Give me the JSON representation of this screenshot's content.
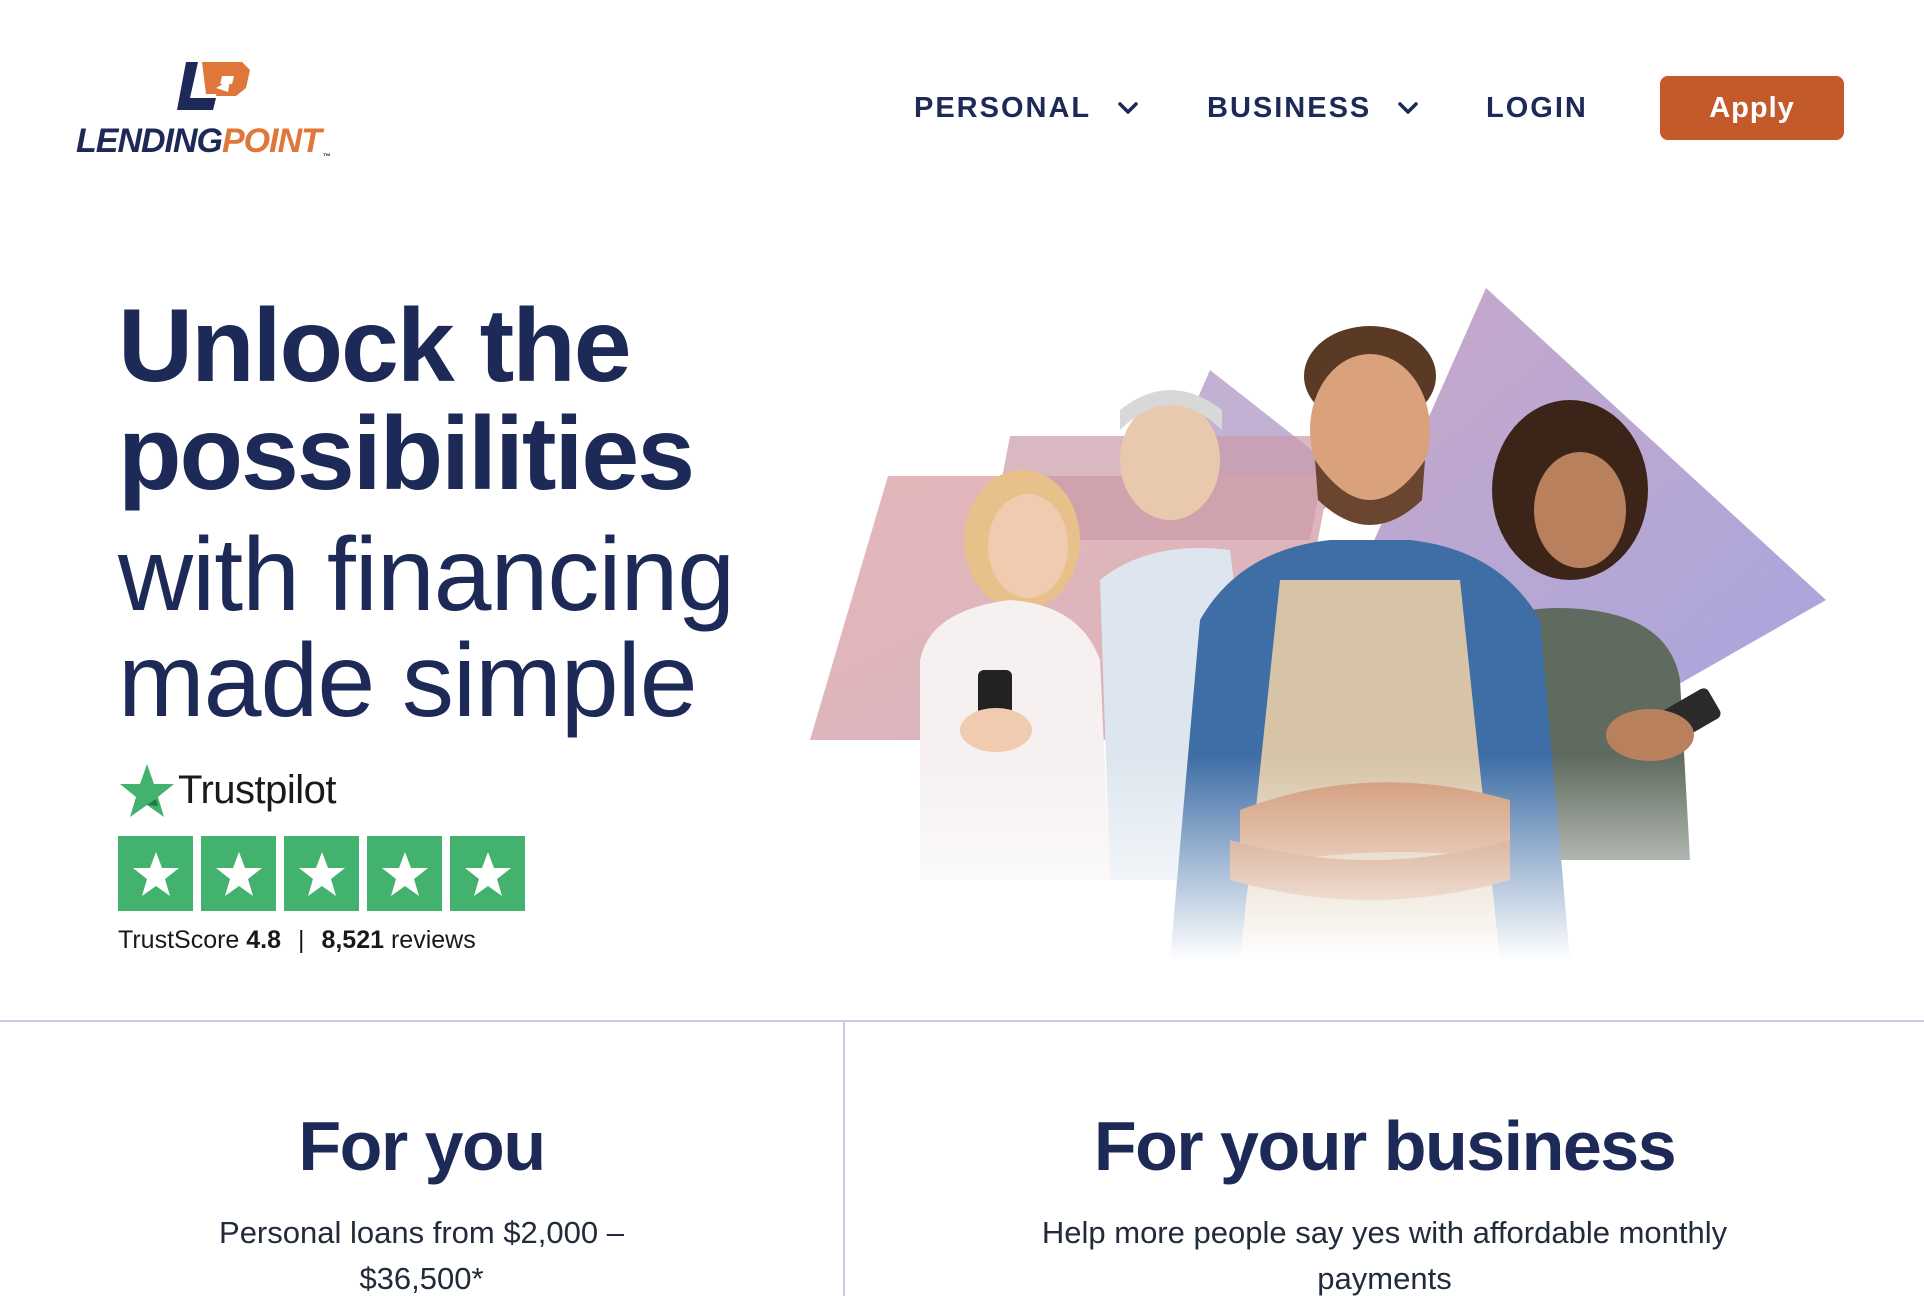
{
  "header": {
    "logo": {
      "text_lending": "LENDING",
      "text_point": "POINT",
      "tm": "™"
    },
    "nav": [
      {
        "label": "PERSONAL",
        "has_dropdown": true,
        "icon": "chevron-down-icon"
      },
      {
        "label": "BUSINESS",
        "has_dropdown": true,
        "icon": "chevron-down-icon"
      },
      {
        "label": "LOGIN",
        "has_dropdown": false
      }
    ],
    "apply_label": "Apply"
  },
  "hero": {
    "title_bold_1": "Unlock the",
    "title_bold_2": "possibilities",
    "title_light_1": "with financing",
    "title_light_2": "made simple"
  },
  "trustpilot": {
    "brand": "Trustpilot",
    "stars": 5,
    "score_label": "TrustScore",
    "score_value": "4.8",
    "separator": "|",
    "reviews_count": "8,521",
    "reviews_label": "reviews"
  },
  "cards": {
    "personal": {
      "title": "For you",
      "text": "Personal loans from $2,000 – $36,500*"
    },
    "business": {
      "title": "For your business",
      "text": "Help more people say yes with affordable monthly payments"
    }
  },
  "colors": {
    "navy": "#1d2a57",
    "brand_orange": "#e0773a",
    "apply_button": "#c4592a",
    "trustpilot_green": "#43b26f",
    "divider": "#c9cde0"
  }
}
